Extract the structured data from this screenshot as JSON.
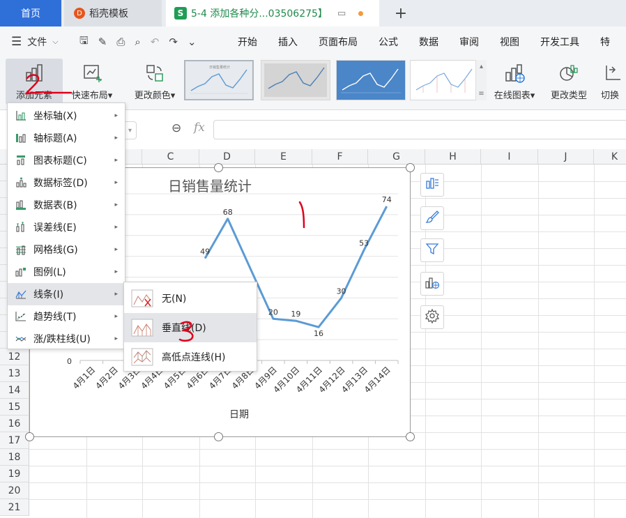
{
  "tabs": {
    "home": "首页",
    "template": "稻壳模板",
    "file": "5-4 添加各种分...03506275】",
    "file_icon": "S",
    "template_icon": "D"
  },
  "menubar": {
    "file_label": "文件",
    "items": [
      "开始",
      "插入",
      "页面布局",
      "公式",
      "数据",
      "审阅",
      "视图",
      "开发工具",
      "特"
    ]
  },
  "ribbon": {
    "add_element": "添加元素",
    "quick_layout": "快速布局",
    "change_color": "更改颜色",
    "online_chart": "在线图表",
    "change_type": "更改类型",
    "switch": "切换"
  },
  "formula": {
    "fx": "fx",
    "value": ""
  },
  "grid": {
    "columns": [
      {
        "label": "C"
      },
      {
        "label": "D"
      },
      {
        "label": "E"
      },
      {
        "label": "F"
      },
      {
        "label": "G"
      },
      {
        "label": "H"
      },
      {
        "label": "I"
      },
      {
        "label": "J"
      },
      {
        "label": "K"
      }
    ],
    "rows": [
      "12",
      "13",
      "14",
      "15",
      "16",
      "17",
      "18",
      "19",
      "20",
      "21"
    ]
  },
  "dropdown": {
    "items": [
      {
        "label": "坐标轴(X)",
        "icon": "axis-icon"
      },
      {
        "label": "轴标题(A)",
        "icon": "axis-title-icon"
      },
      {
        "label": "图表标题(C)",
        "icon": "chart-title-icon"
      },
      {
        "label": "数据标签(D)",
        "icon": "data-label-icon"
      },
      {
        "label": "数据表(B)",
        "icon": "data-table-icon"
      },
      {
        "label": "误差线(E)",
        "icon": "error-bar-icon"
      },
      {
        "label": "网格线(G)",
        "icon": "gridline-icon"
      },
      {
        "label": "图例(L)",
        "icon": "legend-icon"
      },
      {
        "label": "线条(I)",
        "icon": "lines-icon"
      },
      {
        "label": "趋势线(T)",
        "icon": "trendline-icon"
      },
      {
        "label": "涨/跌柱线(U)",
        "icon": "updown-bar-icon"
      }
    ]
  },
  "submenu": {
    "items": [
      {
        "label": "无(N)",
        "icon": "none-line-icon"
      },
      {
        "label": "垂直线(D)",
        "icon": "drop-line-icon"
      },
      {
        "label": "高低点连线(H)",
        "icon": "high-low-line-icon"
      }
    ]
  },
  "chart_data": {
    "type": "line",
    "title": "日销售量统计",
    "xlabel": "日期",
    "ylabel": "",
    "categories": [
      "4月1日",
      "4月2日",
      "4月3日",
      "4月4日",
      "4月5日",
      "4月6日",
      "4月7日",
      "4月8日",
      "4月9日",
      "4月10日",
      "4月11日",
      "4月12日",
      "4月13日",
      "4月14日"
    ],
    "values": [
      null,
      null,
      null,
      null,
      null,
      49,
      68,
      null,
      20,
      19,
      16,
      30,
      53,
      74
    ],
    "visible_labels": [
      "49",
      "68",
      "20",
      "19",
      "16",
      "30",
      "53",
      "74"
    ],
    "y_tick_visible": "0",
    "ylim": [
      0,
      80
    ],
    "grid": true,
    "line_color": "#5b9bd5"
  },
  "annotations": [
    "1",
    "2",
    "3"
  ],
  "colors": {
    "home_tab": "#2f6fd8",
    "accent_green": "#1f9d55",
    "annotation_red": "#e0001b"
  }
}
